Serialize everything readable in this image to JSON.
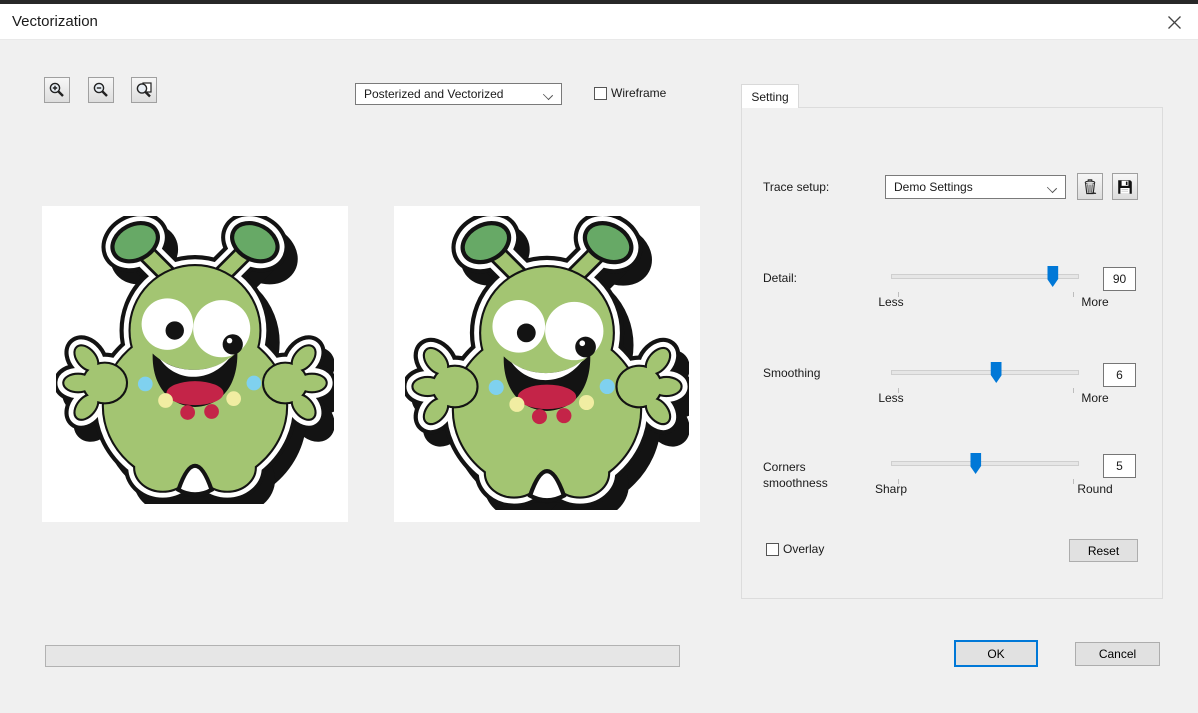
{
  "window": {
    "title": "Vectorization",
    "close_icon": "close"
  },
  "toolbar": {
    "zoom_in_icon": "zoom-in-magnifier-plus",
    "zoom_out_icon": "zoom-out-magnifier-minus",
    "zoom_fit_icon": "zoom-fit-magnifier-page",
    "mode_select": {
      "value": "Posterized and Vectorized",
      "chevron_icon": "chevron-down"
    },
    "wireframe_checkbox": {
      "label": "Wireframe",
      "checked": false
    }
  },
  "settings_panel": {
    "tab_label": "Setting",
    "trace_setup": {
      "label": "Trace setup:",
      "value": "Demo Settings",
      "chevron_icon": "chevron-down",
      "delete_icon": "trash-can",
      "save_icon": "floppy-disk"
    },
    "sliders": [
      {
        "label": "Detail:",
        "min": "Less",
        "max": "More",
        "value": "90",
        "pct": 86
      },
      {
        "label": "Smoothing",
        "min": "Less",
        "max": "More",
        "value": "6",
        "pct": 56
      },
      {
        "label": "Corners smoothness",
        "min": "Sharp",
        "max": "Round",
        "value": "5",
        "pct": 45
      }
    ],
    "overlay_checkbox": {
      "label": "Overlay",
      "checked": false
    },
    "reset_label": "Reset"
  },
  "footer": {
    "progress_percent": 0,
    "ok_label": "OK",
    "cancel_label": "Cancel"
  },
  "colors": {
    "accent": "#0078d7",
    "monster_body": "#a3c572",
    "monster_tip": "#67a966",
    "monster_red": "#c42448",
    "monster_blue": "#7fd1ef",
    "monster_yellow": "#f1eda2",
    "monster_ink": "#131313"
  }
}
